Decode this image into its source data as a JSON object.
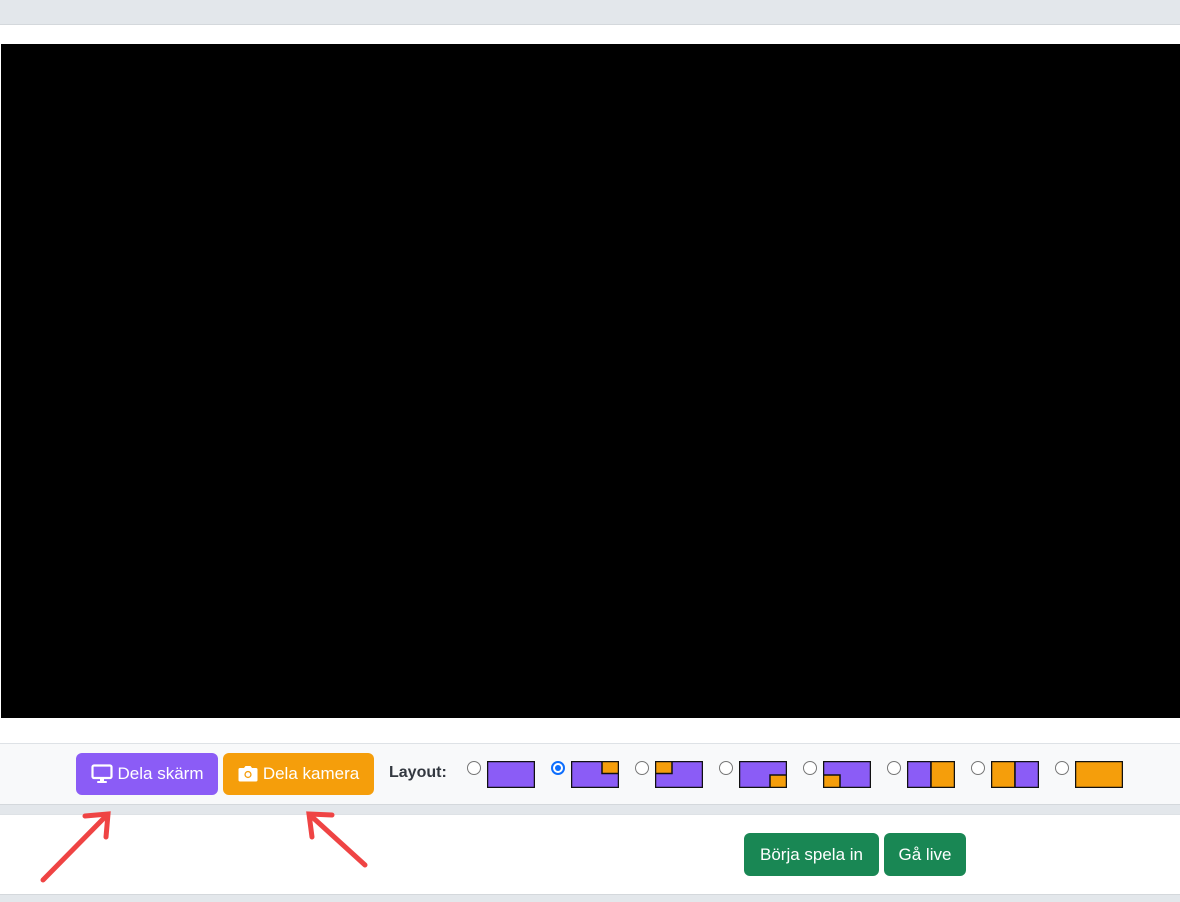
{
  "controls": {
    "share_screen_label": "Dela skärm",
    "share_camera_label": "Dela kamera",
    "layout_label": "Layout:"
  },
  "layout_options": [
    {
      "name": "screen-only",
      "selected": false
    },
    {
      "name": "camera-top-right",
      "selected": true
    },
    {
      "name": "camera-top-left",
      "selected": false
    },
    {
      "name": "camera-bottom-right",
      "selected": false
    },
    {
      "name": "camera-bottom-left",
      "selected": false
    },
    {
      "name": "screen-left-camera-right",
      "selected": false
    },
    {
      "name": "camera-left-screen-right",
      "selected": false
    },
    {
      "name": "camera-only",
      "selected": false
    }
  ],
  "actions": {
    "record_label": "Börja spela in",
    "live_label": "Gå live"
  },
  "colors": {
    "screen_purple": "#8b5cf6",
    "camera_orange": "#f59e0b",
    "action_green": "#198754",
    "radio_blue": "#0d6efd",
    "arrow_red": "#ef4444"
  },
  "icons": {
    "share_screen": "monitor-icon",
    "share_camera": "camera-icon"
  }
}
